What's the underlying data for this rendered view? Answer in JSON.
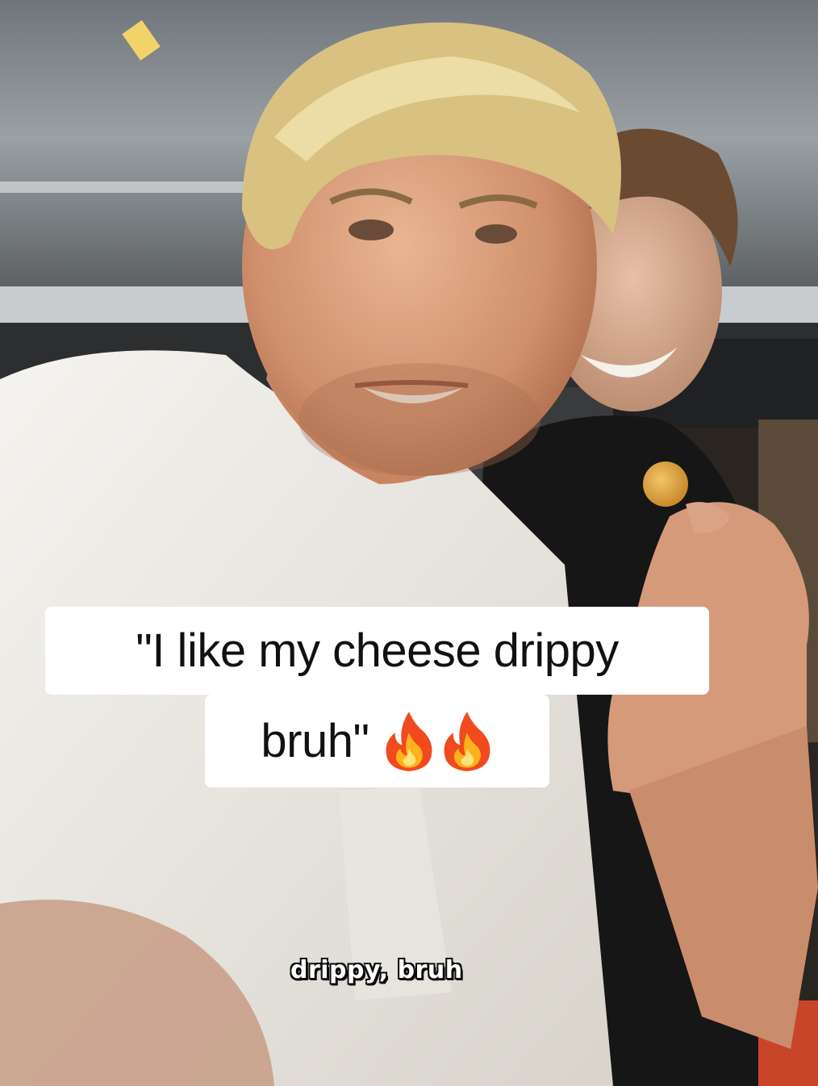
{
  "caption": {
    "line1": "\"I like my cheese drippy",
    "line2": "bruh\""
  },
  "caption_icons": [
    "fire-icon",
    "fire-icon"
  ],
  "subtitle": "drippy, bruh",
  "colors": {
    "caption_bg": "#ffffff",
    "caption_text": "#111111",
    "subtitle_text": "#ffffff",
    "subtitle_shadow": "#0c0c0c"
  }
}
